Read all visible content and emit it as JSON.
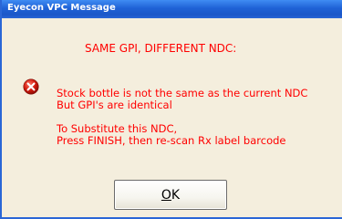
{
  "window": {
    "title": "Eyecon VPC Message"
  },
  "message": {
    "heading": "SAME GPI, DIFFERENT NDC:",
    "line1": "Stock bottle is not the same as the current NDC",
    "line2": "But GPI's are identical",
    "line3": "To Substitute this NDC,",
    "line4": "Press FINISH, then re-scan Rx label barcode",
    "icon": "error-icon",
    "color": "#ff0000"
  },
  "buttons": {
    "ok_label": "OK"
  }
}
